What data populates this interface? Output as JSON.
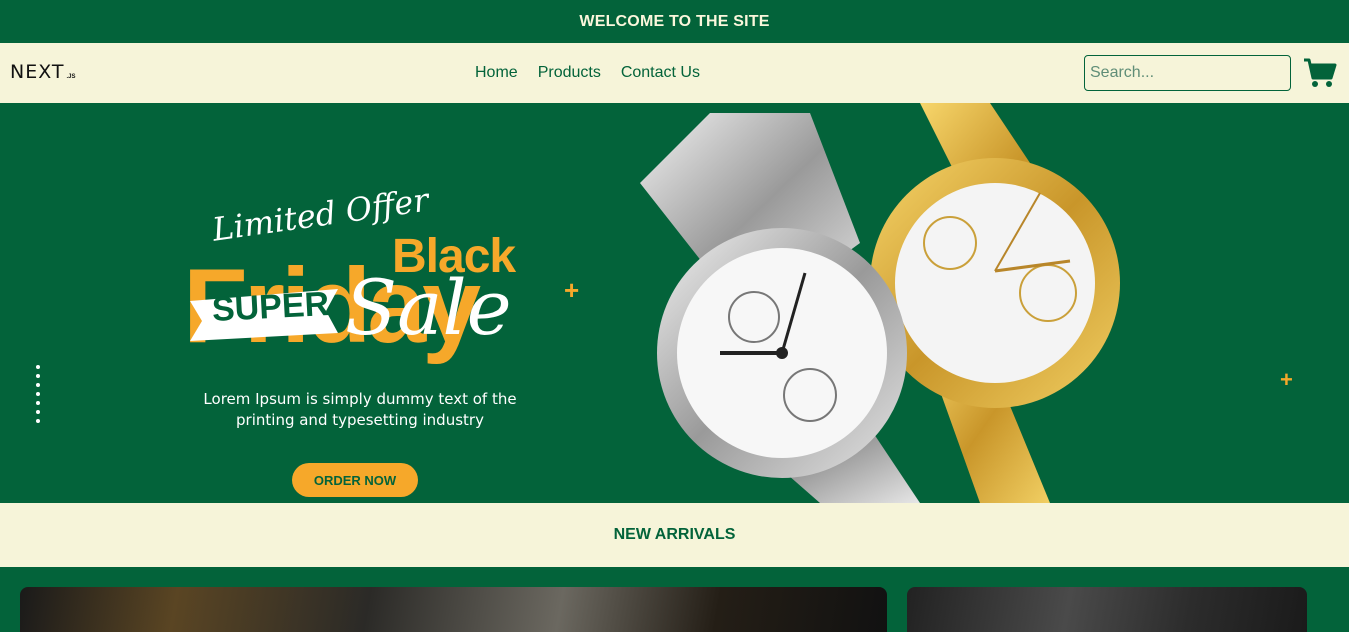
{
  "topbar": {
    "text": "WELCOME TO THE SITE"
  },
  "nav": {
    "logo": {
      "main": "NEXT",
      "sub": ".JS"
    },
    "menu": [
      {
        "label": "Home"
      },
      {
        "label": "Products"
      },
      {
        "label": "Contact Us"
      }
    ],
    "search": {
      "placeholder": "Search...",
      "value": ""
    },
    "cart_icon": "cart-icon"
  },
  "hero": {
    "limited": "Limited Offer",
    "black": "Black",
    "friday": "Friday",
    "super": "SUPER",
    "sale": "Sale",
    "description": "Lorem Ipsum is simply dummy text of the printing and typesetting industry",
    "cta": "ORDER NOW",
    "accent": "#f6a82a",
    "background": "#03633a"
  },
  "arrivals": {
    "title": "NEW ARRIVALS"
  },
  "colors": {
    "brand": "#03633a",
    "cream": "#f6f4d9",
    "accent": "#f6a82a"
  }
}
